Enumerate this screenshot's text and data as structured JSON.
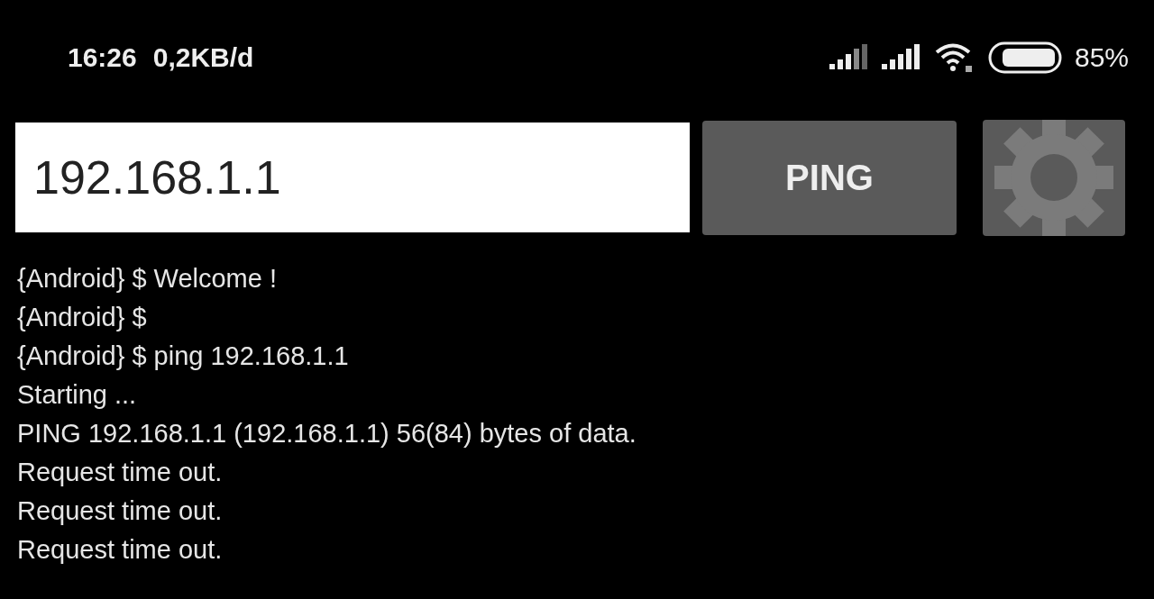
{
  "status_bar": {
    "time": "16:26",
    "data_rate": "0,2KB/d",
    "battery_percent": "85%"
  },
  "address_field": {
    "value": "192.168.1.1"
  },
  "ping_button": {
    "label": "PING"
  },
  "console": {
    "lines": [
      "{Android} $ Welcome !",
      "{Android} $",
      "{Android} $ ping 192.168.1.1",
      "Starting ...",
      "PING 192.168.1.1 (192.168.1.1) 56(84) bytes of data.",
      "Request time out.",
      "Request time out.",
      "Request time out."
    ]
  }
}
